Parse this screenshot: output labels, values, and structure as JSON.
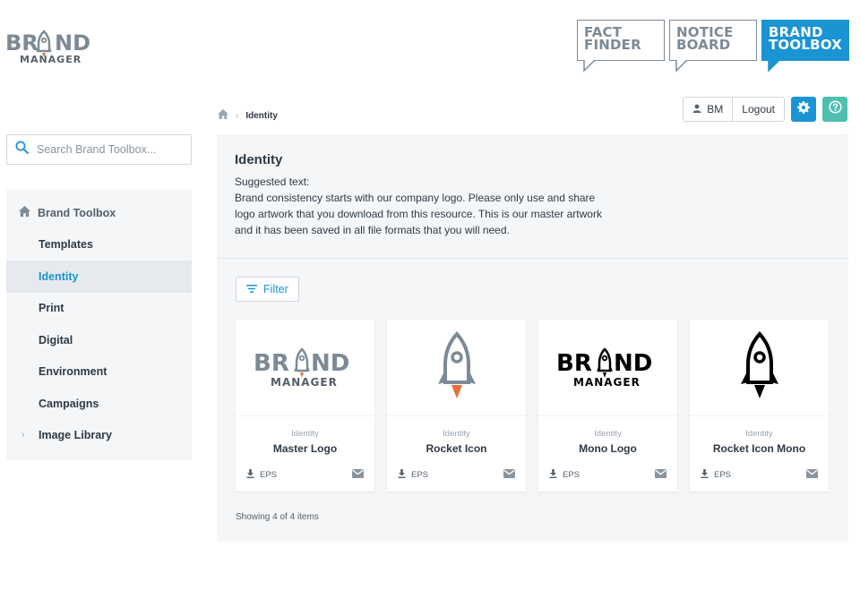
{
  "brand": {
    "logo_top": "BRAND",
    "logo_bottom": "MANAGER"
  },
  "topnav": [
    {
      "line1": "FACT",
      "line2": "FINDER",
      "active": false
    },
    {
      "line1": "NOTICE",
      "line2": "BOARD",
      "active": false
    },
    {
      "line1": "BRAND",
      "line2": "TOOLBOX",
      "active": true
    }
  ],
  "breadcrumb": {
    "current": "Identity"
  },
  "header": {
    "user_label": "BM",
    "logout_label": "Logout"
  },
  "search": {
    "placeholder": "Search Brand Toolbox..."
  },
  "sidebar": {
    "root_label": "Brand Toolbox",
    "items": [
      {
        "label": "Templates"
      },
      {
        "label": "Identity",
        "active": true
      },
      {
        "label": "Print"
      },
      {
        "label": "Digital"
      },
      {
        "label": "Environment"
      },
      {
        "label": "Campaigns"
      },
      {
        "label": "Image Library",
        "expandable": true
      }
    ]
  },
  "main": {
    "title": "Identity",
    "subtitle": "Suggested text:",
    "body": "Brand consistency starts with our company logo. Please only use and share logo artwork that you download from this resource. This is our master artwork and it has been saved in all file formats that you will need.",
    "filter_label": "Filter",
    "cards": [
      {
        "category": "Identity",
        "title": "Master Logo",
        "format": "EPS"
      },
      {
        "category": "Identity",
        "title": "Rocket Icon",
        "format": "EPS"
      },
      {
        "category": "Identity",
        "title": "Mono Logo",
        "format": "EPS"
      },
      {
        "category": "Identity",
        "title": "Rocket Icon Mono",
        "format": "EPS"
      }
    ],
    "count_text": "Showing 4 of 4 items"
  },
  "colors": {
    "accent": "#1a94d2",
    "help": "#4fc0b0",
    "rocket_flame": "#e8703a",
    "logo_grey": "#7d8a96",
    "panel_bg": "#f4f6f8"
  }
}
